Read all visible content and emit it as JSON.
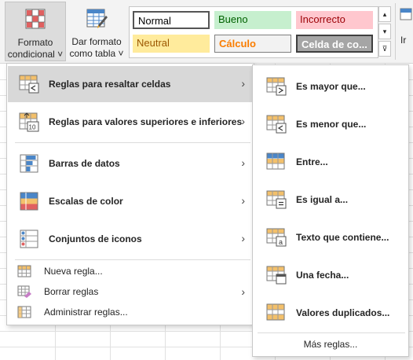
{
  "ribbon": {
    "conditional_format": {
      "line1": "Formato",
      "line2": "condicional ˅"
    },
    "format_table": {
      "line1": "Dar formato",
      "line2": "como tabla ˅"
    },
    "styles": [
      {
        "label": "Normal",
        "bg": "#ffffff",
        "fg": "#000000"
      },
      {
        "label": "Bueno",
        "bg": "#c6efce",
        "fg": "#006100"
      },
      {
        "label": "Incorrecto",
        "bg": "#ffc7ce",
        "fg": "#9c0006"
      },
      {
        "label": "Neutral",
        "bg": "#ffeb9c",
        "fg": "#9c5700"
      },
      {
        "label": "Cálculo",
        "bg": "#f2f2f2",
        "fg": "#fa7d00"
      },
      {
        "label": "Celda de co...",
        "bg": "#a5a5a5",
        "fg": "#ffffff"
      }
    ],
    "scroll_up": "▴",
    "scroll_down": "▾",
    "more_styles": "⊽",
    "next_group_label": "Ir"
  },
  "menu": {
    "items": [
      {
        "label": "Reglas para resaltar celdas",
        "icon": "highlight-cells-rules-icon",
        "highlighted": true,
        "submenu": true
      },
      {
        "label": "Reglas para valores superiores e inferiores",
        "icon": "top-bottom-rules-icon",
        "submenu": true
      },
      {
        "label": "Barras de datos",
        "icon": "data-bars-icon",
        "submenu": true
      },
      {
        "label": "Escalas de color",
        "icon": "color-scales-icon",
        "submenu": true
      },
      {
        "label": "Conjuntos de iconos",
        "icon": "icon-sets-icon",
        "submenu": true
      }
    ],
    "small_items": [
      {
        "label": "Nueva regla...",
        "icon": "new-rule-icon"
      },
      {
        "label": "Borrar reglas",
        "icon": "clear-rules-icon",
        "submenu": true
      },
      {
        "label": "Administrar reglas...",
        "icon": "manage-rules-icon"
      }
    ],
    "arrow": "›"
  },
  "submenu": {
    "items": [
      {
        "label": "Es mayor que...",
        "icon": "greater-than-icon"
      },
      {
        "label": "Es menor que...",
        "icon": "less-than-icon"
      },
      {
        "label": "Entre...",
        "icon": "between-icon"
      },
      {
        "label": "Es igual a...",
        "icon": "equal-to-icon"
      },
      {
        "label": "Texto que contiene...",
        "icon": "text-contains-icon"
      },
      {
        "label": "Una fecha...",
        "icon": "date-occurring-icon"
      },
      {
        "label": "Valores duplicados...",
        "icon": "duplicate-values-icon"
      }
    ],
    "more_rules": "Más reglas..."
  }
}
